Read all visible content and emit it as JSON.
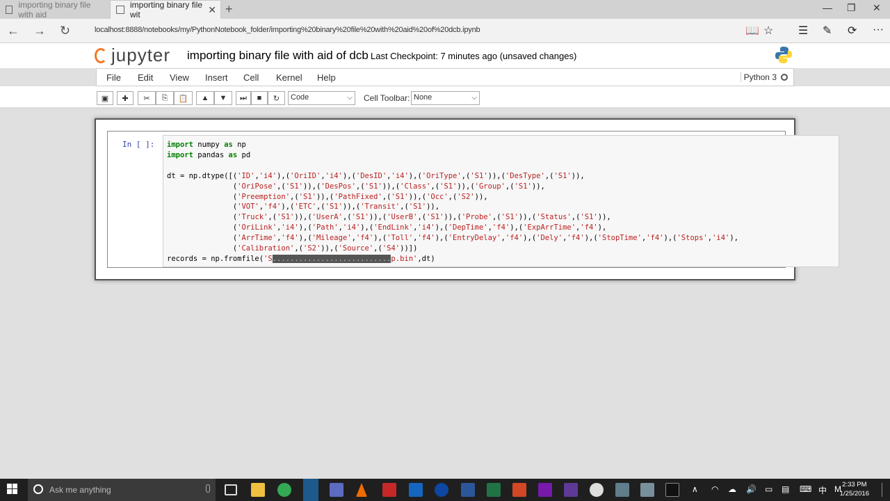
{
  "browser": {
    "inactive_tab_label": "importing binary file with aid",
    "active_tab_label": "importing binary file wit",
    "close_glyph": "✕",
    "new_tab_glyph": "+",
    "url": "localhost:8888/notebooks/my/PythonNotebook_folder/importing%20binary%20file%20with%20aid%20of%20dcb.ipynb"
  },
  "header": {
    "logo_text": "jupyter",
    "notebook_title": "importing binary file with aid of dcb",
    "checkpoint": "Last Checkpoint: 7 minutes ago (unsaved changes)"
  },
  "menu": {
    "items": [
      "File",
      "Edit",
      "View",
      "Insert",
      "Cell",
      "Kernel",
      "Help"
    ],
    "kernel_name": "Python 3"
  },
  "toolbar": {
    "cell_type": "Code",
    "cell_toolbar_label": "Cell Toolbar:",
    "cell_toolbar_value": "None"
  },
  "cell": {
    "prompt": "In [ ]:"
  },
  "taskbar": {
    "search_placeholder": "Ask me anything",
    "time": "2:33 PM",
    "date": "1/25/2016",
    "ime": "中",
    "ime2": "M"
  },
  "colors": {
    "jupyter_orange": "#f37726",
    "keyword_green": "#008000",
    "string_red": "#ba2121",
    "prompt_blue": "#303f9f"
  }
}
